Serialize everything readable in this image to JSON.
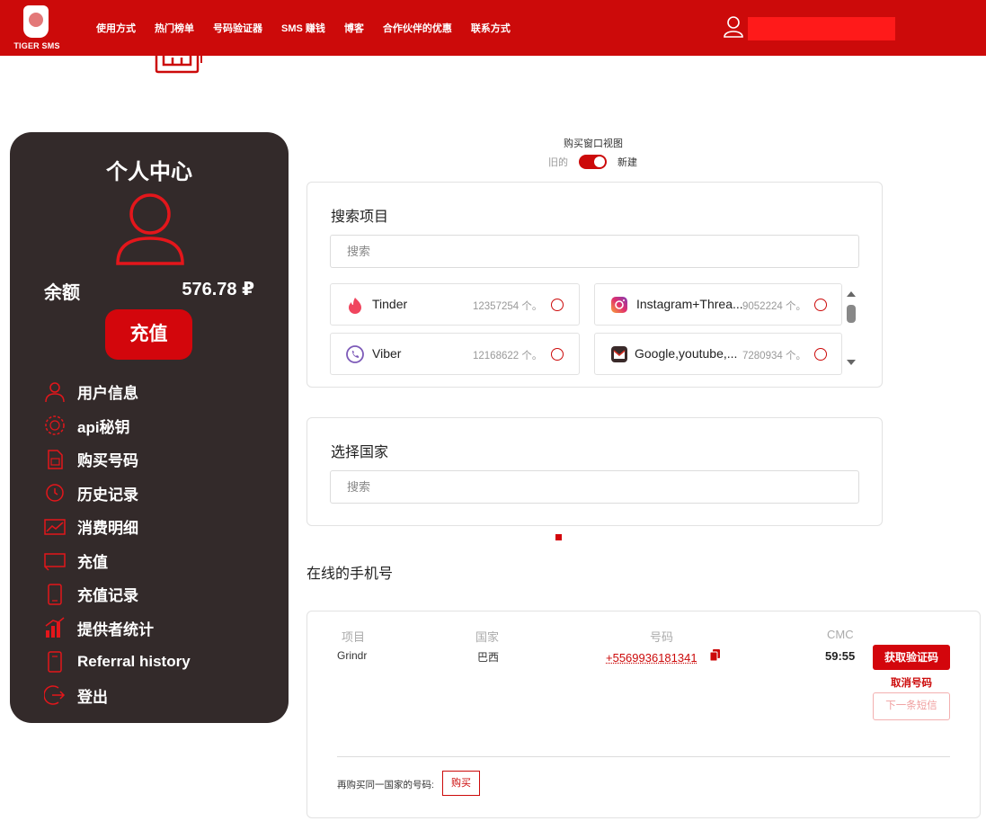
{
  "brand": {
    "logo_text": "TIGER SMS"
  },
  "nav": {
    "items": [
      "使用方式",
      "热门榜单",
      "号码验证器",
      "SMS 赚钱",
      "博客",
      "合作伙伴的优惠",
      "联系方式"
    ]
  },
  "account_panel": {
    "title": "个人中心",
    "balance_label": "余额",
    "balance_value": "576.78 ₽",
    "topup_button": "充值",
    "menu": [
      {
        "label": "用户信息",
        "icon": "user-icon"
      },
      {
        "label": "api秘钥",
        "icon": "api-key-icon"
      },
      {
        "label": "购买号码",
        "icon": "sim-card-icon"
      },
      {
        "label": "历史记录",
        "icon": "history-icon"
      },
      {
        "label": "消费明细",
        "icon": "chart-icon"
      },
      {
        "label": "充值",
        "icon": "wallet-icon"
      },
      {
        "label": "充值记录",
        "icon": "receipt-icon"
      },
      {
        "label": "提供者统计",
        "icon": "bar-chart-icon"
      },
      {
        "label": "Referral history",
        "icon": "referral-icon"
      },
      {
        "label": "登出",
        "icon": "logout-icon"
      }
    ]
  },
  "view_toggle": {
    "title": "购买窗口视图",
    "old_label": "旧的",
    "new_label": "新建",
    "state": "new"
  },
  "service_search": {
    "title": "搜索项目",
    "placeholder": "搜索",
    "services": [
      {
        "name": "Tinder",
        "count": "12357254 个。",
        "icon": "tinder-icon"
      },
      {
        "name": "Instagram+Threa...",
        "count": "9052224 个。",
        "icon": "instagram-icon"
      },
      {
        "name": "Viber",
        "count": "12168622 个。",
        "icon": "viber-icon"
      },
      {
        "name": "Google,youtube,...",
        "count": "7280934 个。",
        "icon": "gmail-icon"
      }
    ]
  },
  "country_search": {
    "title": "选择国家",
    "placeholder": "搜索"
  },
  "online_numbers": {
    "title": "在线的手机号",
    "columns": [
      "项目",
      "国家",
      "号码",
      "CMC"
    ],
    "rows": [
      {
        "service": "Grindr",
        "country": "巴西",
        "number": "+5569936181341",
        "timer": "59:55"
      }
    ],
    "get_code_button": "获取验证码",
    "cancel_link": "取消号码",
    "next_sms_button": "下一条短信",
    "rebuy_label": "再购买同一国家的号码:",
    "rebuy_button": "购买"
  },
  "colors": {
    "brand_red": "#cc0a0a",
    "panel_dark": "#332a2a"
  }
}
